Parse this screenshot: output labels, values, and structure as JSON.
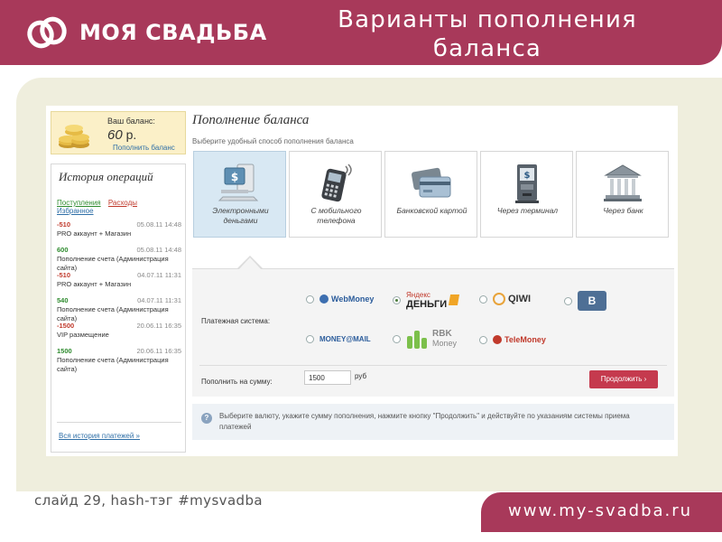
{
  "header": {
    "logo_text": "МОЯ СВАДЬБА",
    "title_line1": "Варианты пополнения",
    "title_line2": "баланса",
    "brand_color": "#a8395a"
  },
  "balance": {
    "label": "Ваш баланс:",
    "amount": "60",
    "currency": "р.",
    "topup_link": "Пополнить баланс"
  },
  "history": {
    "title": "История операций",
    "tabs": [
      "Поступления",
      "Расходы",
      "Избранное"
    ],
    "operations": [
      {
        "amount": "-510",
        "date": "05.08.11 14:48",
        "desc": "PRO аккаунт + Магазин",
        "color": "#c0392b"
      },
      {
        "amount": "600",
        "date": "05.08.11 14:48",
        "desc": "Пополнение счета (Администрация сайта)",
        "color": "#2e8b2e"
      },
      {
        "amount": "-510",
        "date": "04.07.11 11:31",
        "desc": "PRO аккаунт + Магазин",
        "color": "#c0392b"
      },
      {
        "amount": "540",
        "date": "04.07.11 11:31",
        "desc": "Пополнение счета (Администрация сайта)",
        "color": "#2e8b2e"
      },
      {
        "amount": "-1500",
        "date": "20.06.11 16:35",
        "desc": "VIP размещение",
        "color": "#c0392b"
      },
      {
        "amount": "1500",
        "date": "20.06.11 16:35",
        "desc": "Пополнение счета (Администрация сайта)",
        "color": "#2e8b2e"
      }
    ],
    "all_link": "Вся история платежей »"
  },
  "main": {
    "title": "Пополнение баланса",
    "subtitle": "Выберите удобный способ пополнения баланса",
    "methods": [
      {
        "label": "Электронными деньгами",
        "icon": "e-money-icon",
        "active": true
      },
      {
        "label": "С мобильного телефона",
        "icon": "mobile-phone-icon",
        "active": false
      },
      {
        "label": "Банковской картой",
        "icon": "bank-card-icon",
        "active": false
      },
      {
        "label": "Через терминал",
        "icon": "terminal-icon",
        "active": false
      },
      {
        "label": "Через банк",
        "icon": "bank-building-icon",
        "active": false
      }
    ]
  },
  "form": {
    "payment_label": "Платежная система:",
    "systems": {
      "webmoney": "WebMoney",
      "yandex_top": "Яндекс",
      "yandex_bottom": "ДЕНЬГИ",
      "qiwi": "QIWI",
      "vk": "B",
      "moneymail": "MONEY@MAIL",
      "rbk_top": "RBK",
      "rbk_bottom": "Money",
      "telemoney": "TeleMoney"
    },
    "selected_system": "Яндекс ДЕНЬГИ",
    "amount_label": "Пополнить на сумму:",
    "amount_value": "1500",
    "amount_unit": "руб",
    "continue_label": "Продолжить  ›",
    "accent_color": "#c53a4e"
  },
  "hint": {
    "icon": "info-icon",
    "text": "Выберите валюту, укажите сумму пополнения, нажмите кнопку \"Продолжить\" и действуйте по указаниям системы приема платежей"
  },
  "footer": {
    "slide_label": "слайд 29, hash-тэг #mysvadba",
    "url": "www.my-svadba.ru"
  }
}
